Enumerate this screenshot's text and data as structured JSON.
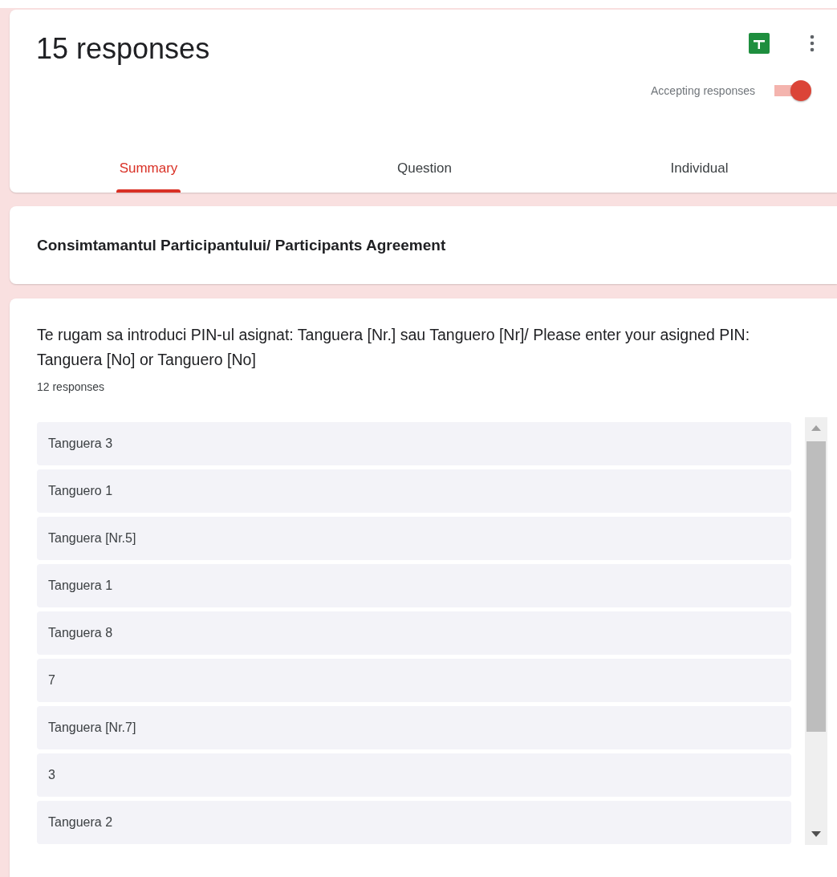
{
  "header": {
    "title": "15 responses",
    "accepting": {
      "label": "Accepting responses",
      "on": true
    }
  },
  "tabs": [
    {
      "label": "Summary",
      "selected": true
    },
    {
      "label": "Question",
      "selected": false
    },
    {
      "label": "Individual",
      "selected": false
    }
  ],
  "section": {
    "title": "Consimtamantul Participantului/ Participants Agreement"
  },
  "question": {
    "title": "Te rugam sa introduci PIN-ul asignat: Tanguera [Nr.] sau Tanguero [Nr]/ Please enter your asigned PIN: Tanguera [No] or Tanguero [No]",
    "count": "12 responses",
    "answers": [
      "Tanguera 3",
      "Tanguero 1",
      "Tanguera [Nr.5]",
      "Tanguera 1",
      "Tanguera 8",
      "7",
      "Tanguera [Nr.7]",
      "3",
      "Tanguera 2"
    ]
  }
}
